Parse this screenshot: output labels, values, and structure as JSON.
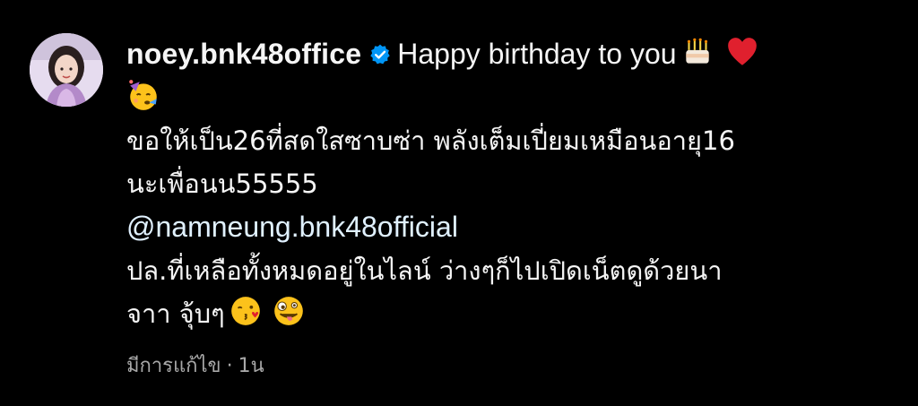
{
  "comment": {
    "username": "noey.bnk48office",
    "verified": true,
    "first_text": "Happy birthday to you",
    "emojis_line1": [
      "cake-emoji",
      "red-heart-emoji"
    ],
    "emojis_line2": [
      "partying-face-emoji"
    ],
    "line3": "ขอให้เป็น26ที่สดใสซาบซ่า พลังเต็มเปี่ยมเหมือนอายุ16",
    "line4": "นะเพื่อนน55555",
    "mention": "@namneung.bnk48official",
    "line6": "ปล.ที่เหลือทั้งหมดอยู่ในไลน์ ว่างๆก็ไปเปิดเน็ตดูด้วยนา",
    "line7": "จาา จุ้บๆ",
    "emojis_line7": [
      "face-blowing-kiss-emoji",
      "zany-face-emoji"
    ]
  },
  "meta": {
    "edited": "มีการแก้ไข",
    "separator": "·",
    "time": "1น"
  },
  "colors": {
    "background": "#000000",
    "text": "#f5f5f5",
    "mention": "#e0f1ff",
    "meta": "#a8a8a8",
    "verified": "#0095f6"
  }
}
